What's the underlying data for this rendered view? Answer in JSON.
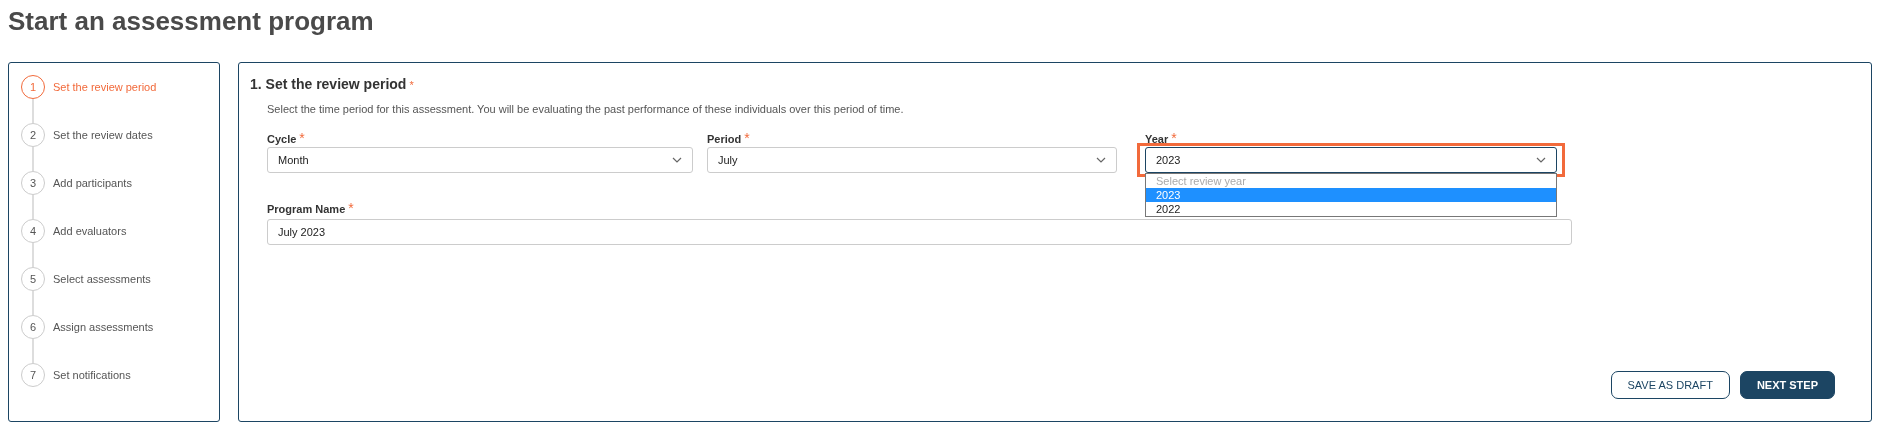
{
  "page_title": "Start an assessment program",
  "steps": [
    {
      "number": "1",
      "label": "Set the review period",
      "selected": true
    },
    {
      "number": "2",
      "label": "Set the review dates",
      "selected": false
    },
    {
      "number": "3",
      "label": "Add participants",
      "selected": false
    },
    {
      "number": "4",
      "label": "Add evaluators",
      "selected": false
    },
    {
      "number": "5",
      "label": "Select assessments",
      "selected": false
    },
    {
      "number": "6",
      "label": "Assign assessments",
      "selected": false
    },
    {
      "number": "7",
      "label": "Set notifications",
      "selected": false
    }
  ],
  "section": {
    "title": "1. Set the review period",
    "required_mark": "*",
    "description": "Select the time period for this assessment. You will be evaluating the past performance of these individuals over this period of time."
  },
  "fields": [
    {
      "kind": "select",
      "label": "Cycle",
      "required_mark": "*",
      "value": "Month",
      "expanded": false
    },
    {
      "kind": "select",
      "label": "Period",
      "required_mark": "*",
      "value": "July",
      "expanded": false
    },
    {
      "kind": "select",
      "label": "Year",
      "required_mark": "*",
      "value": "2023",
      "highlighted": true,
      "expanded": true,
      "options": [
        {
          "label": "Select review year",
          "kind": "placeholder",
          "selected": false
        },
        {
          "label": "2023",
          "kind": "option",
          "selected": true
        },
        {
          "label": "2022",
          "kind": "option",
          "selected": false
        }
      ]
    }
  ],
  "name_field": {
    "label": "Program Name",
    "required_mark": "*",
    "value": "July 2023"
  },
  "buttons": [
    {
      "label": "SAVE AS DRAFT",
      "kind": "secondary"
    },
    {
      "label": "NEXT STEP",
      "kind": "primary"
    }
  ]
}
